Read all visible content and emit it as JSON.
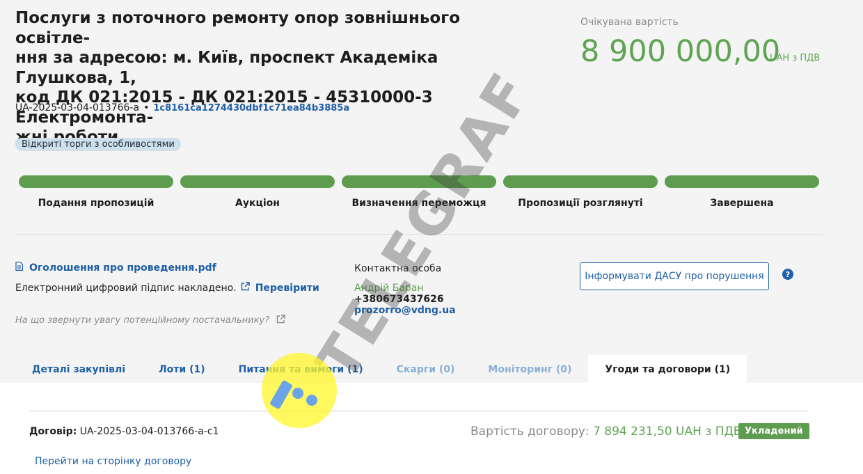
{
  "tender": {
    "title": "Послуги з поточного ремонту опор зовнішнього освітле-\nння за адресою: м. Київ, проспект Академіка Глушкова, 1,\nкод ДК 021:2015 - ДК 021:2015 - 45310000-3 Електромонта-\nжні роботи",
    "id": "UA-2025-03-04-013766-a",
    "hash": "1c8161ca1274430dbf1c71ea84b3885a",
    "procedure_type": "Відкриті торги з особливостями"
  },
  "price": {
    "label": "Очікувана вартість",
    "value": "8 900 000,00",
    "currency": "UAH з ПДВ"
  },
  "stages": [
    {
      "label": "Подання пропозицій",
      "status": "done"
    },
    {
      "label": "Аукціон",
      "status": "done"
    },
    {
      "label": "Визначення переможця",
      "status": "done"
    },
    {
      "label": "Пропозиції розглянуті",
      "status": "done"
    },
    {
      "label": "Завершена",
      "status": "done"
    }
  ],
  "documents": {
    "announcement_link": "Оголошення про проведення.pdf",
    "signature_text": "Електронний цифровий підпис накладено.",
    "verify_link": "Перевірити",
    "hint": "На що звернути увагу потенційному постачальнику?"
  },
  "contact": {
    "label": "Контактна особа",
    "name": "Андрій Баран",
    "phone": "+380673437626",
    "email": "prozorro@vdng.ua"
  },
  "actions": {
    "dasu_button": "Інформувати ДАСУ про порушення",
    "help": "?"
  },
  "tabs": [
    {
      "label": "Деталі закупівлі",
      "state": "normal"
    },
    {
      "label": "Лоти (1)",
      "state": "normal"
    },
    {
      "label": "Питання та вимоги (1)",
      "state": "normal"
    },
    {
      "label": "Скарги (0)",
      "state": "disabled"
    },
    {
      "label": "Моніторинг (0)",
      "state": "disabled"
    },
    {
      "label": "Угоди та договори (1)",
      "state": "active"
    }
  ],
  "contract": {
    "id_label": "Договір:",
    "id": "UA-2025-03-04-013766-a-c1",
    "price_label": "Вартість договору:",
    "price_value": "7 894 231,50 UAH з ПДВ",
    "status": "Укладений",
    "goto_link": "Перейти на сторінку договору"
  },
  "watermark": {
    "text": "TELEGRAF"
  },
  "colors": {
    "accent_blue": "#1e5fa6",
    "success_green": "#5e9c50",
    "price_green": "#5ea452"
  }
}
